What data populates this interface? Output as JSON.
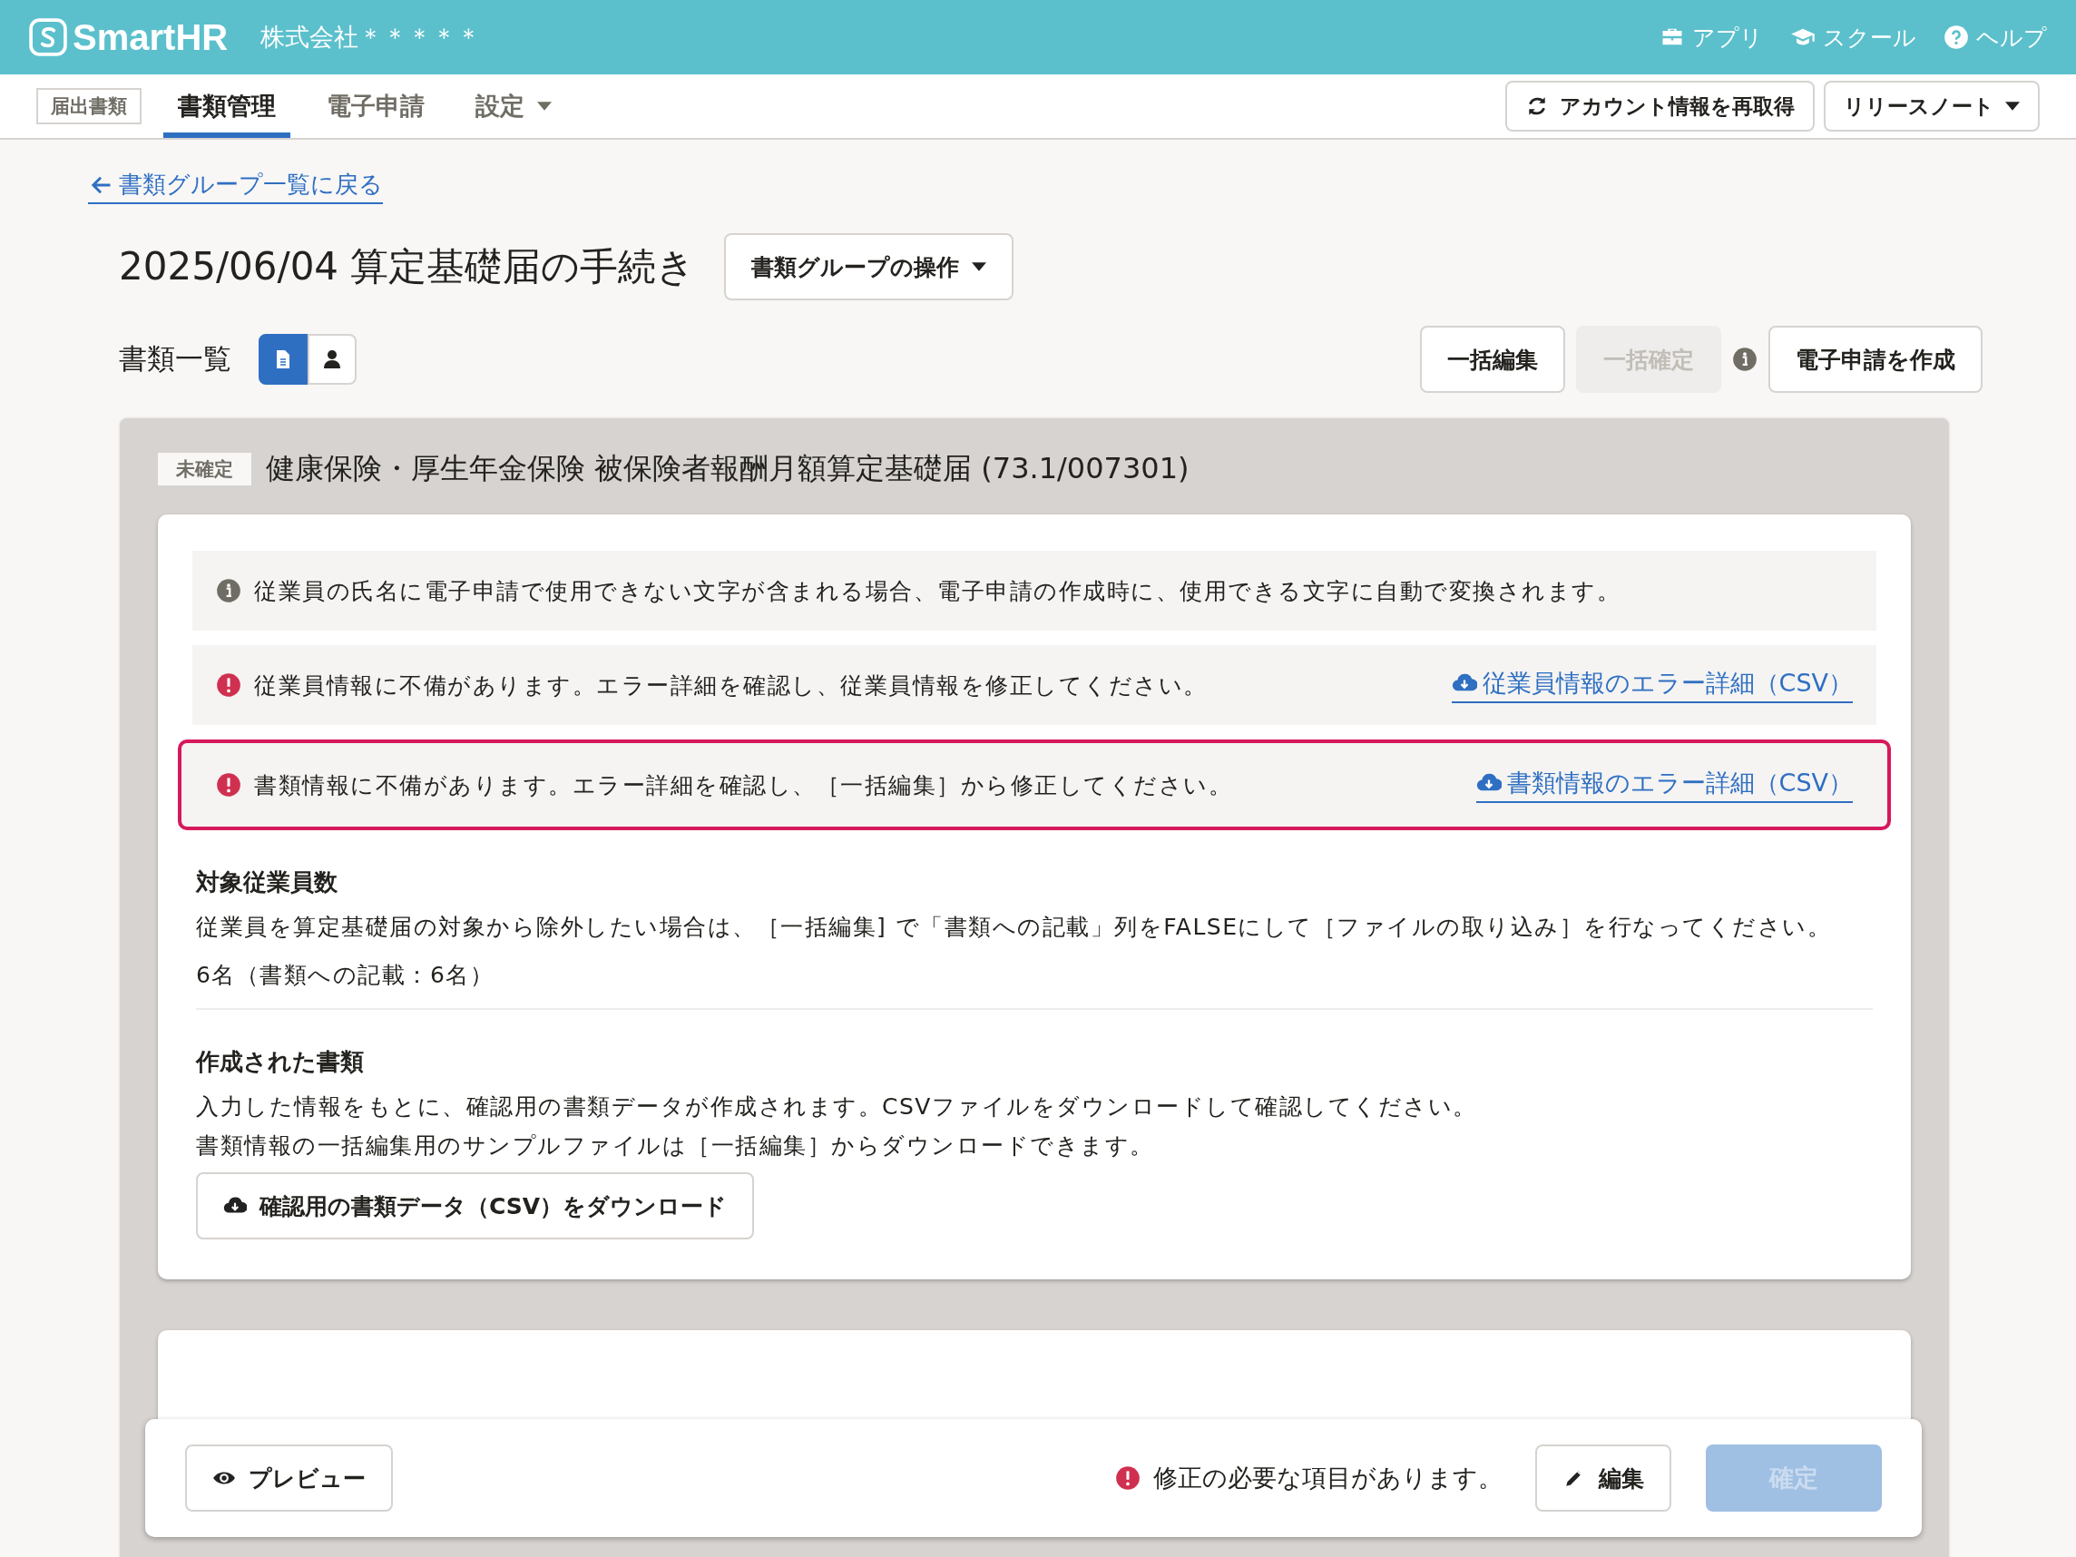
{
  "header": {
    "logo": "SmartHR",
    "company": "株式会社＊＊＊＊＊",
    "links": [
      {
        "label": "アプリ"
      },
      {
        "label": "スクール"
      },
      {
        "label": "ヘルプ"
      }
    ]
  },
  "nav": {
    "tag": "届出書類",
    "tabs": [
      {
        "label": "書類管理",
        "selected": true,
        "has_menu": false
      },
      {
        "label": "電子申請",
        "selected": false,
        "has_menu": false
      },
      {
        "label": "設定",
        "selected": false,
        "has_menu": true
      }
    ],
    "buttons": [
      {
        "label": "アカウント情報を再取得",
        "kind": "refresh"
      },
      {
        "label": "リリースノート",
        "kind": "menu"
      }
    ]
  },
  "back_link": "書類グループ一覧に戻る",
  "title": "2025/06/04 算定基礎届の手続き",
  "group_menu_button": "書類グループの操作",
  "list_label": "書類一覧",
  "view_toggle": [
    {
      "kind": "document",
      "selected": true
    },
    {
      "kind": "person",
      "selected": false
    }
  ],
  "actions": [
    {
      "label": "一括編集",
      "disabled": false,
      "info": false
    },
    {
      "label": "一括確定",
      "disabled": true,
      "info": true
    },
    {
      "label": "電子申請を作成",
      "disabled": false,
      "info": false
    }
  ],
  "document": {
    "status": "未確定",
    "title": "健康保険・厚生年金保険 被保険者報酬月額算定基礎届 (73.1/007301)",
    "notices": [
      {
        "kind": "info",
        "text": "従業員の氏名に電子申請で使用できない文字が含まれる場合、電子申請の作成時に、使用できる文字に自動で変換されます。",
        "highlighted": false
      },
      {
        "kind": "error",
        "text": "従業員情報に不備があります。エラー詳細を確認し、従業員情報を修正してください。",
        "link": "従業員情報のエラー詳細（CSV）",
        "highlighted": false
      },
      {
        "kind": "error",
        "text": "書類情報に不備があります。エラー詳細を確認し、［一括編集］から修正してください。",
        "link": "書類情報のエラー詳細（CSV）",
        "highlighted": true
      }
    ],
    "sections": [
      {
        "heading": "対象従業員数",
        "paragraphs": [
          "従業員を算定基礎届の対象から除外したい場合は、［一括編集] で「書類への記載」列をFALSEにして［ファイルの取り込み］を行なってください。"
        ],
        "value": "6名（書類への記載：6名）"
      },
      {
        "heading": "作成された書類",
        "paragraphs": [
          "入力した情報をもとに、確認用の書類データが作成されます。CSVファイルをダウンロードして確認してください。",
          "書類情報の一括編集用のサンプルファイルは［一括編集］からダウンロードできます。"
        ],
        "button": "確認用の書類データ（CSV）をダウンロード"
      }
    ]
  },
  "footer": {
    "preview": "プレビュー",
    "warning": "修正の必要な項目があります。",
    "edit": "編集",
    "confirm": {
      "label": "確定",
      "disabled": true
    }
  }
}
